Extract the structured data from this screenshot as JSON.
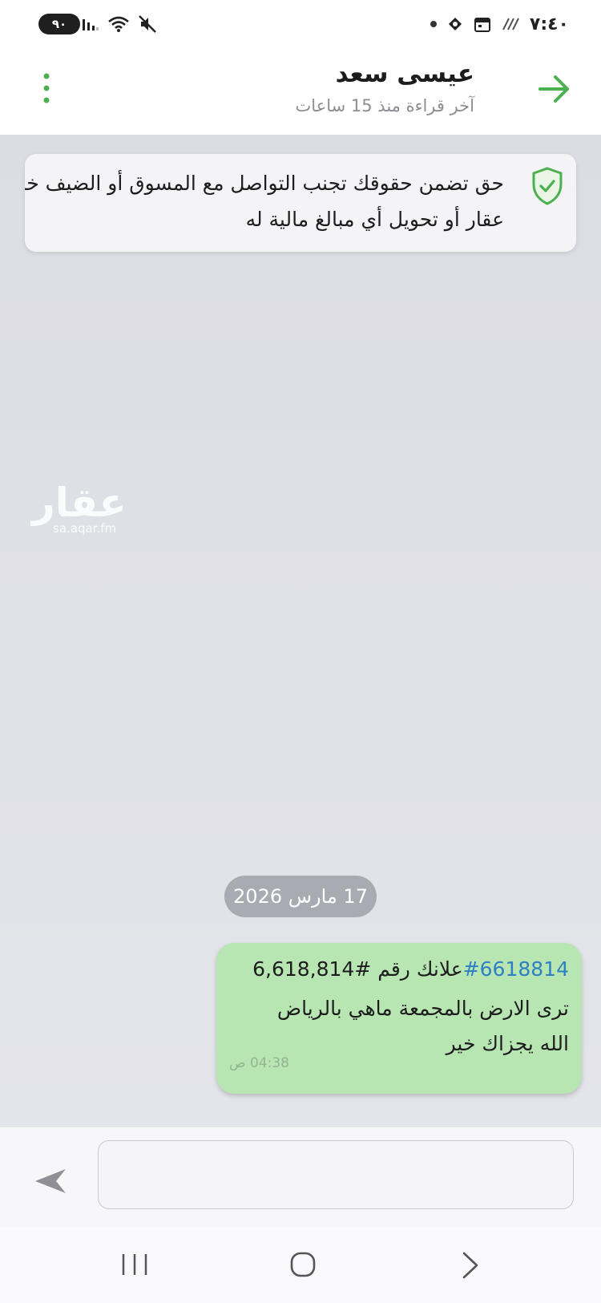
{
  "status_bar": {
    "time": "٧:٤٠",
    "battery": "٩٠"
  },
  "header": {
    "contact_name": "عيسى سعد",
    "last_seen": "آخر قراءة منذ 15 ساعات"
  },
  "notice": {
    "text": "حق تضمن حقوقك تجنب التواصل مع المسوق أو الضيف خارج عقار أو تحويل أي مبالغ مالية له"
  },
  "watermark": {
    "brand": "عقار",
    "domain": "sa.aqar.fm"
  },
  "chat": {
    "date_label": "17 مارس 2026",
    "message": {
      "ad_label": "علانك رقم #",
      "ad_number": "6,618,814",
      "hashtag": "#6618814",
      "body_line1": "ترى الارض بالمجمعة ماهي بالرياض",
      "body_line2": "الله يجزاك خير",
      "time": "04:38 ص"
    }
  },
  "composer": {
    "placeholder": ""
  },
  "colors": {
    "accent_green": "#4caf50",
    "bubble_green": "#b8e6b3",
    "hashtag_blue": "#2f7fc1",
    "chat_background": "#dcdde3"
  }
}
